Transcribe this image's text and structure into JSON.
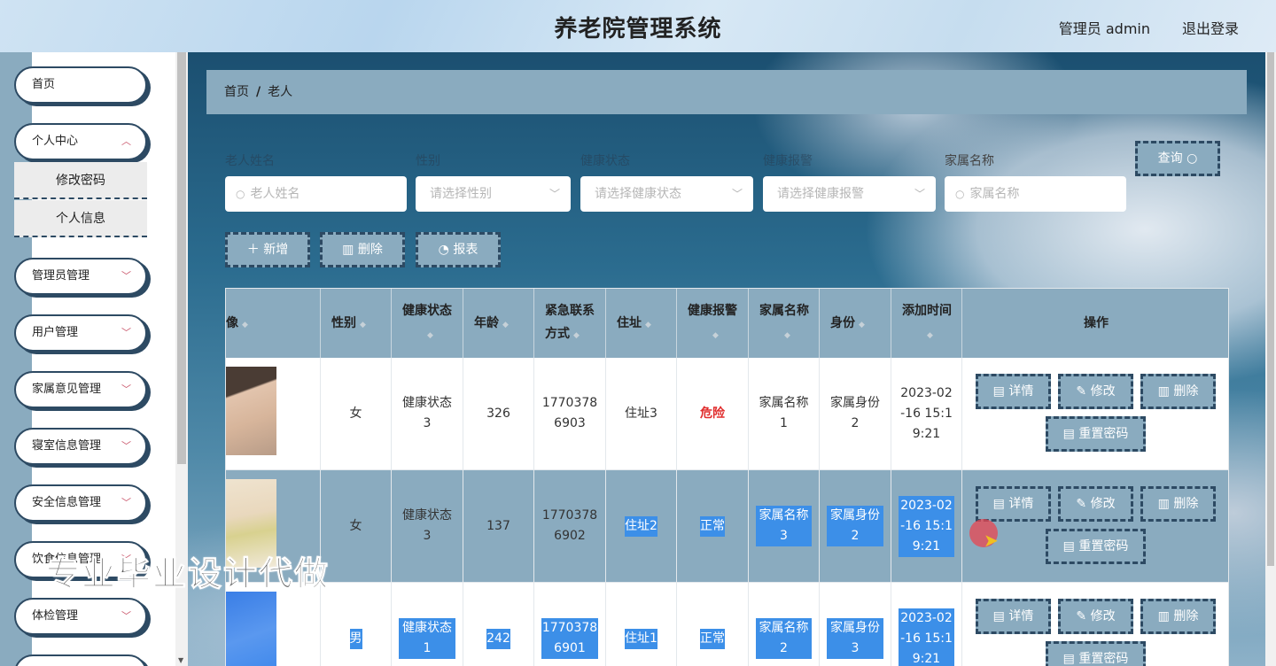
{
  "app": {
    "title": "养老院管理系统",
    "user_label": "管理员 admin",
    "logout_label": "退出登录"
  },
  "sidebar": {
    "items": [
      {
        "label": "首页",
        "has_arrow": false
      },
      {
        "label": "个人中心",
        "has_arrow": true
      },
      {
        "label": "管理员管理",
        "has_arrow": true
      },
      {
        "label": "用户管理",
        "has_arrow": true
      },
      {
        "label": "家属意见管理",
        "has_arrow": true
      },
      {
        "label": "寝室信息管理",
        "has_arrow": true
      },
      {
        "label": "安全信息管理",
        "has_arrow": true
      },
      {
        "label": "饮食信息管理",
        "has_arrow": true
      },
      {
        "label": "体检管理",
        "has_arrow": true
      }
    ],
    "submenu": [
      "修改密码",
      "个人信息"
    ]
  },
  "breadcrumb": {
    "home": "首页",
    "sep": "/",
    "current": "老人"
  },
  "filters": {
    "labels": [
      "老人姓名",
      "性别",
      "健康状态",
      "健康报警",
      "家属名称"
    ],
    "placeholders": [
      "老人姓名",
      "请选择性别",
      "请选择健康状态",
      "请选择健康报警",
      "家属名称"
    ],
    "query_button": "查询"
  },
  "actions": {
    "add": "新增",
    "delete": "删除",
    "report": "报表"
  },
  "table": {
    "headers": [
      "像",
      "性别",
      "健康状态",
      "年龄",
      "紧急联系方式",
      "住址",
      "健康报警",
      "家属名称",
      "身份",
      "添加时间",
      "操作"
    ],
    "rows": [
      {
        "gender": "女",
        "health": "健康状态3",
        "age": "326",
        "phone": "17703786903",
        "address": "住址3",
        "alarm": "危险",
        "family": "家属名称1",
        "identity": "家属身份2",
        "time": "2023-02-16 15:19:21"
      },
      {
        "gender": "女",
        "health": "健康状态3",
        "age": "137",
        "phone": "17703786902",
        "address": "住址2",
        "alarm": "正常",
        "family": "家属名称3",
        "identity": "家属身份2",
        "time": "2023-02-16 15:19:21"
      },
      {
        "gender": "男",
        "health": "健康状态1",
        "age": "242",
        "phone": "17703786901",
        "address": "住址1",
        "alarm": "正常",
        "family": "家属名称2",
        "identity": "家属身份3",
        "time": "2023-02-16 15:19:21"
      }
    ],
    "row_buttons": {
      "detail": "详情",
      "edit": "修改",
      "delete": "删除",
      "reset": "重置密码"
    }
  },
  "watermark": "专业毕业设计代做",
  "colors": {
    "accent": "#8aabbf",
    "border": "#2d4a63",
    "selection": "#3c8fe8",
    "danger": "#e02c2c"
  }
}
